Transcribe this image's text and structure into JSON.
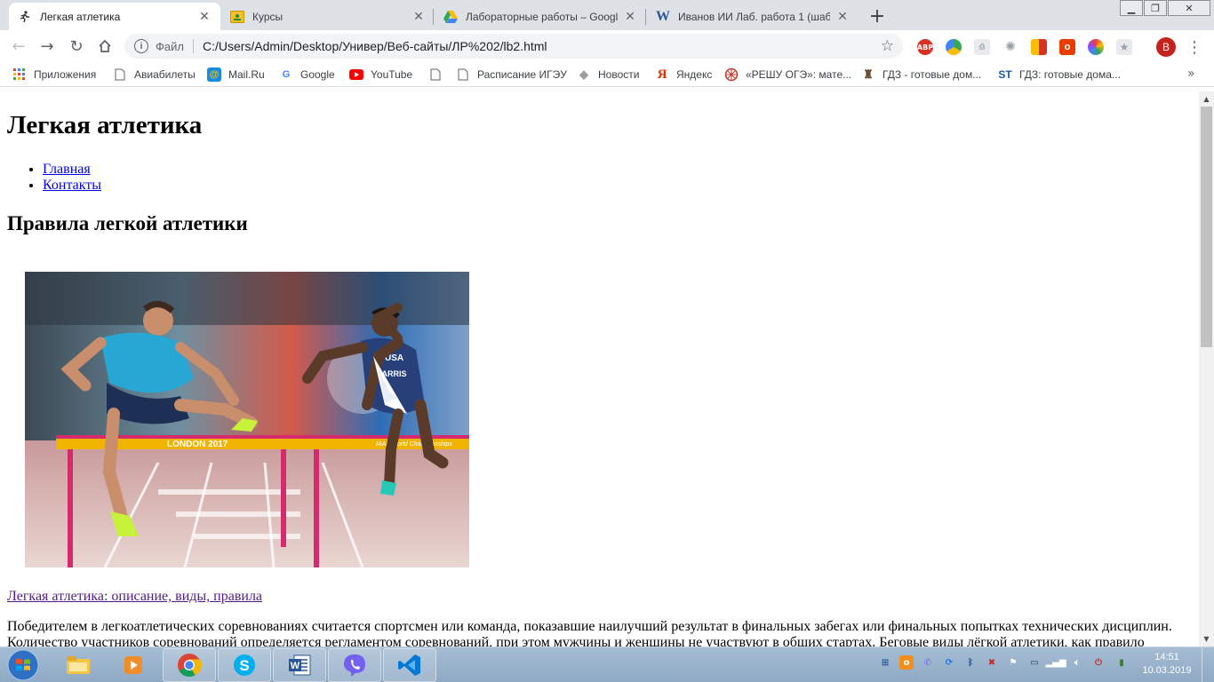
{
  "tabs": [
    {
      "title": "Легкая атлетика",
      "icon": "runner-icon",
      "active": true
    },
    {
      "title": "Курсы",
      "icon": "classroom-icon",
      "active": false
    },
    {
      "title": "Лабораторные работы – Google",
      "icon": "google-drive-icon",
      "active": false
    },
    {
      "title": "Иванов ИИ Лаб. работа 1 (шабл",
      "icon": "word-icon",
      "active": false
    }
  ],
  "omnibox": {
    "scheme_label": "Файл",
    "url": "C:/Users/Admin/Desktop/Универ/Веб-сайты/ЛР%202/lb2.html"
  },
  "profile_initial": "B",
  "extensions": [
    "adblock-icon",
    "chrome-green-icon",
    "pdf-icon",
    "puzzle-icon",
    "flag-icon",
    "office-icon",
    "colorful-icon",
    "extension-icon"
  ],
  "bookmarks": [
    {
      "label": "Приложения",
      "icon": "apps-grid-icon"
    },
    {
      "label": "Авиабилеты",
      "icon": "page-icon"
    },
    {
      "label": "Mail.Ru",
      "icon": "mailru-icon"
    },
    {
      "label": "Google",
      "icon": "google-icon"
    },
    {
      "label": "YouTube",
      "icon": "youtube-icon"
    },
    {
      "label": "",
      "icon": "page-icon"
    },
    {
      "label": "Расписание ИГЭУ",
      "icon": "page-icon"
    },
    {
      "label": "Новости",
      "icon": "news-icon"
    },
    {
      "label": "Яндекс",
      "icon": "yandex-icon"
    },
    {
      "label": "«РЕШУ ОГЭ»: мате...",
      "icon": "reshu-icon"
    },
    {
      "label": "ГДЗ - готовые дом...",
      "icon": "gdz-icon"
    },
    {
      "label": "ГДЗ: готовые дома...",
      "icon": "st-icon"
    }
  ],
  "page": {
    "h1": "Легкая атлетика",
    "nav": [
      "Главная",
      "Контакты"
    ],
    "h2": "Правила легкой атлетики",
    "image_banner_text": [
      "LONDON 2017",
      "IAAF World Championships"
    ],
    "image_bibs": [
      "USA",
      "HARRIS"
    ],
    "image_link": "Легкая атлетика: описание, виды, правила",
    "paragraph": "Победителем в легкоатлетических соревнованиях считается спортсмен или команда, показавшие наилучший результат в финальных забегах или финальных попытках технических дисциплин. Количество участников соревнований определяется регламентом соревнований, при этом мужчины и женщины не участвуют в общих стартах. Беговые виды лёгкой атлетики, как правило"
  },
  "taskbar": {
    "apps": [
      "explorer-icon",
      "media-player-icon",
      "chrome-icon",
      "skype-icon",
      "word-icon",
      "viber-icon",
      "vscode-icon"
    ],
    "time": "14:51",
    "date": "10.03.2019"
  },
  "colors": {
    "link": "#0000ee",
    "visited_link": "#551a8b",
    "tabstrip": "#dee1e6",
    "profile": "#c5221f"
  }
}
